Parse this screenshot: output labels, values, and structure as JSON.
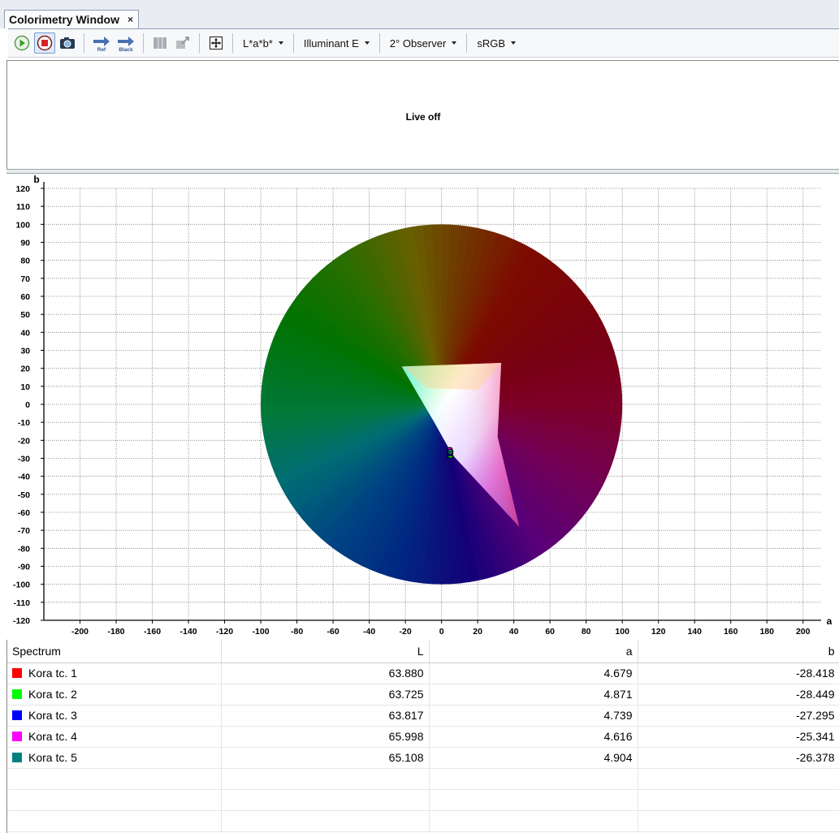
{
  "window": {
    "tab_title": "Colorimetry Window",
    "tab_close": "×"
  },
  "toolbar": {
    "buttons": [
      {
        "name": "play-icon"
      },
      {
        "name": "stop-icon"
      },
      {
        "name": "camera-icon"
      },
      {
        "name": "ref-arrow-icon",
        "caption": "Ref"
      },
      {
        "name": "black-arrow-icon",
        "caption": "Black"
      },
      {
        "name": "columns-icon"
      },
      {
        "name": "export-icon"
      },
      {
        "name": "zoom-fit-icon"
      }
    ],
    "dropdowns": [
      {
        "label": "L*a*b*"
      },
      {
        "label": "Illuminant E"
      },
      {
        "label": "2° Observer"
      },
      {
        "label": "sRGB"
      }
    ]
  },
  "live": {
    "status": "Live off"
  },
  "chart_data": {
    "type": "scatter",
    "xlabel": "a",
    "ylabel": "b",
    "xlim": [
      -220,
      210
    ],
    "ylim": [
      -120,
      120
    ],
    "xticks": [
      -200,
      -180,
      -160,
      -140,
      -120,
      -100,
      -80,
      -60,
      -40,
      -20,
      0,
      20,
      40,
      60,
      80,
      100,
      120,
      140,
      160,
      180,
      200
    ],
    "yticks": [
      120,
      110,
      100,
      90,
      80,
      70,
      60,
      50,
      40,
      30,
      20,
      10,
      0,
      -10,
      -20,
      -30,
      -40,
      -50,
      -60,
      -70,
      -80,
      -90,
      -100,
      -110,
      -120
    ],
    "grid": true,
    "background_disk_radius": 100,
    "points": [
      {
        "a": 4.679,
        "b": -28.418,
        "color": "#ff0000"
      },
      {
        "a": 4.871,
        "b": -28.449,
        "color": "#00ff00"
      },
      {
        "a": 4.739,
        "b": -27.295,
        "color": "#0000ff"
      },
      {
        "a": 4.616,
        "b": -25.341,
        "color": "#ff00ff"
      },
      {
        "a": 4.904,
        "b": -26.378,
        "color": "#008080"
      }
    ]
  },
  "table": {
    "columns": [
      "Spectrum",
      "L",
      "a",
      "b"
    ],
    "rows": [
      {
        "color": "#ff0000",
        "name": "Kora tc. 1",
        "L": "63.880",
        "a": "4.679",
        "b": "-28.418"
      },
      {
        "color": "#00ff00",
        "name": "Kora tc. 2",
        "L": "63.725",
        "a": "4.871",
        "b": "-28.449"
      },
      {
        "color": "#0000ff",
        "name": "Kora tc. 3",
        "L": "63.817",
        "a": "4.739",
        "b": "-27.295"
      },
      {
        "color": "#ff00ff",
        "name": "Kora tc. 4",
        "L": "65.998",
        "a": "4.616",
        "b": "-25.341"
      },
      {
        "color": "#008080",
        "name": "Kora tc. 5",
        "L": "65.108",
        "a": "4.904",
        "b": "-26.378"
      }
    ],
    "empty_rows": 3
  }
}
